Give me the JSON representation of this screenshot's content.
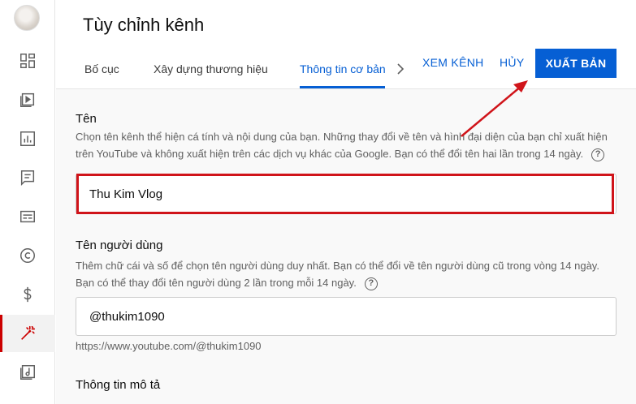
{
  "header": {
    "title": "Tùy chỉnh kênh",
    "tabs": [
      {
        "label": "Bố cục"
      },
      {
        "label": "Xây dựng thương hiệu"
      },
      {
        "label": "Thông tin cơ bản"
      }
    ],
    "view_channel_label": "XEM KÊNH",
    "cancel_label": "HỦY",
    "publish_label": "XUẤT BẢN"
  },
  "sidebar": {
    "items": [
      {
        "icon": "dashboard-icon"
      },
      {
        "icon": "content-icon"
      },
      {
        "icon": "analytics-icon"
      },
      {
        "icon": "comments-icon"
      },
      {
        "icon": "subtitles-icon"
      },
      {
        "icon": "copyright-icon"
      },
      {
        "icon": "monetization-icon"
      },
      {
        "icon": "customization-icon",
        "active": true
      },
      {
        "icon": "audio-library-icon"
      }
    ]
  },
  "name_section": {
    "title": "Tên",
    "description": "Chọn tên kênh thể hiện cá tính và nội dung của bạn. Những thay đổi về tên và hình đại diện của bạn chỉ xuất hiện trên YouTube và không xuất hiện trên các dịch vụ khác của Google. Bạn có thể đổi tên hai lần trong 14 ngày.",
    "value": "Thu Kim Vlog"
  },
  "handle_section": {
    "title": "Tên người dùng",
    "description": "Thêm chữ cái và số để chọn tên người dùng duy nhất. Bạn có thể đổi về tên người dùng cũ trong vòng 14 ngày. Bạn có thể thay đổi tên người dùng 2 lần trong mỗi 14 ngày.",
    "value": "@thukim1090",
    "url": "https://www.youtube.com/@thukim1090"
  },
  "description_section": {
    "title": "Thông tin mô tả"
  },
  "colors": {
    "accent": "#065fd4",
    "highlight": "#d0141a",
    "active_indicator": "#cc0000"
  }
}
